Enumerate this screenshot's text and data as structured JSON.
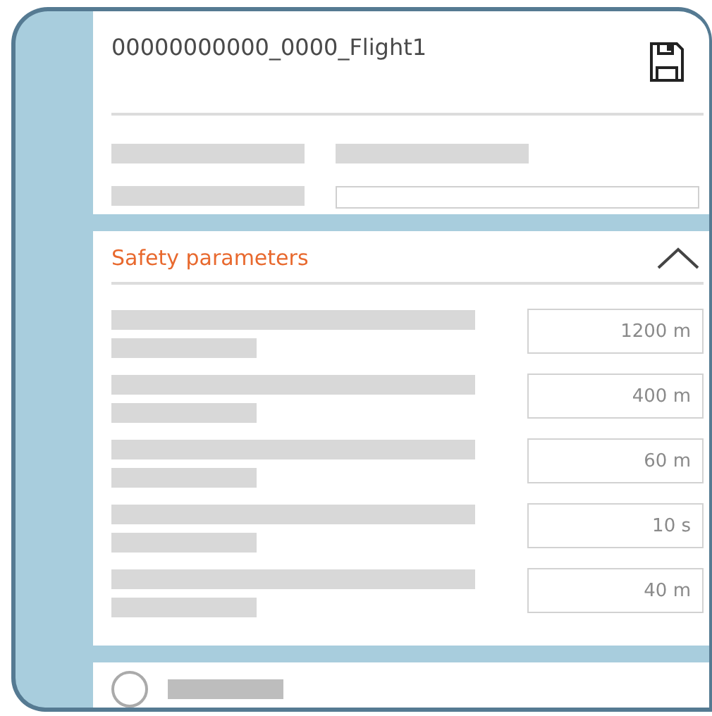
{
  "file": {
    "title": "00000000000_0000_Flight1"
  },
  "safety": {
    "title": "Safety parameters",
    "expanded": true,
    "parameters": [
      {
        "value": "1200 m"
      },
      {
        "value": "400 m"
      },
      {
        "value": "60 m"
      },
      {
        "value": "10 s"
      },
      {
        "value": "40 m"
      }
    ]
  },
  "next_item": {
    "selected": false
  }
}
